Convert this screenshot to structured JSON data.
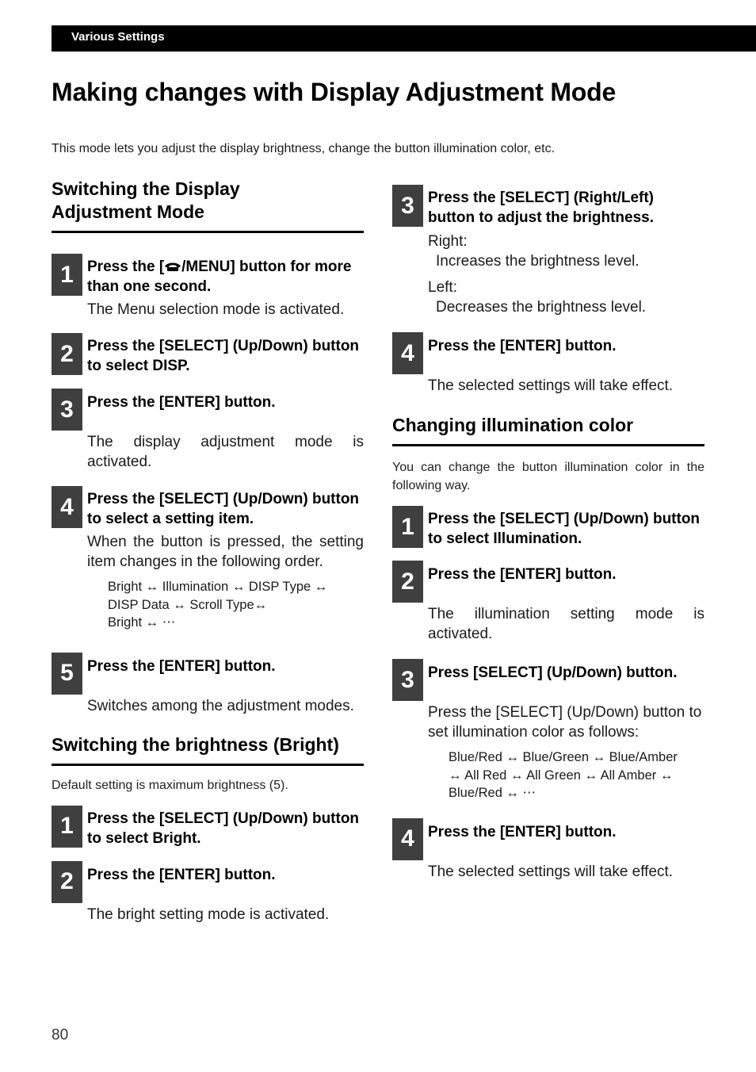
{
  "header": {
    "section": "Various Settings"
  },
  "title": "Making changes with Display Adjustment Mode",
  "intro": "This mode lets you adjust the display brightness, change the button illumination color, etc.",
  "sections": {
    "switching_mode": {
      "title_line1": "Switching the Display",
      "title_line2": "Adjustment Mode",
      "steps": [
        {
          "num": "1",
          "head_pre": "Press the [",
          "head_icon": "phone-icon",
          "head_post": "/MENU] button for more than one second.",
          "body": "The Menu selection mode is activated."
        },
        {
          "num": "2",
          "head": "Press the [SELECT] (Up/Down) button to select DISP."
        },
        {
          "num": "3",
          "head": "Press the [ENTER] button.",
          "body": "The display adjustment mode is activated."
        },
        {
          "num": "4",
          "head": "Press the [SELECT] (Up/Down) button to select a setting item.",
          "body": "When the button is pressed, the setting item changes in the following order.",
          "sequence": [
            "Bright ↔ Illumination ↔ DISP Type ↔",
            "DISP Data ↔ Scroll Type↔",
            "Bright ↔ ⋯"
          ]
        },
        {
          "num": "5",
          "head": "Press the [ENTER] button.",
          "body": "Switches among the adjustment modes."
        }
      ]
    },
    "brightness": {
      "title": "Switching the brightness (Bright)",
      "note": "Default setting is maximum brightness (5).",
      "steps": [
        {
          "num": "1",
          "head": "Press the [SELECT] (Up/Down) button to select Bright."
        },
        {
          "num": "2",
          "head": "Press the [ENTER] button.",
          "body": "The bright setting mode is activated."
        },
        {
          "num": "3",
          "head": "Press the [SELECT] (Right/Left) button to adjust the brightness.",
          "right_label": "Right:",
          "right_text": "Increases the brightness level.",
          "left_label": "Left:",
          "left_text": "Decreases the brightness level."
        },
        {
          "num": "4",
          "head": "Press the [ENTER] button.",
          "body": "The selected settings will take effect."
        }
      ]
    },
    "illumination": {
      "title": "Changing illumination color",
      "note": "You can change the button illumination color in the following way.",
      "steps": [
        {
          "num": "1",
          "head": "Press the [SELECT] (Up/Down) button to select Illumination."
        },
        {
          "num": "2",
          "head": "Press the [ENTER] button.",
          "body": "The illumination setting mode is activated."
        },
        {
          "num": "3",
          "head": "Press [SELECT] (Up/Down) button.",
          "body": "Press the [SELECT] (Up/Down) button to set illumination color as follows:",
          "sequence": [
            "Blue/Red ↔ Blue/Green ↔ Blue/Amber",
            "↔ All Red ↔ All Green ↔ All Amber ↔",
            "Blue/Red ↔ ⋯"
          ]
        },
        {
          "num": "4",
          "head": "Press the [ENTER] button.",
          "body": "The selected settings will take effect."
        }
      ]
    }
  },
  "page_number": "80"
}
